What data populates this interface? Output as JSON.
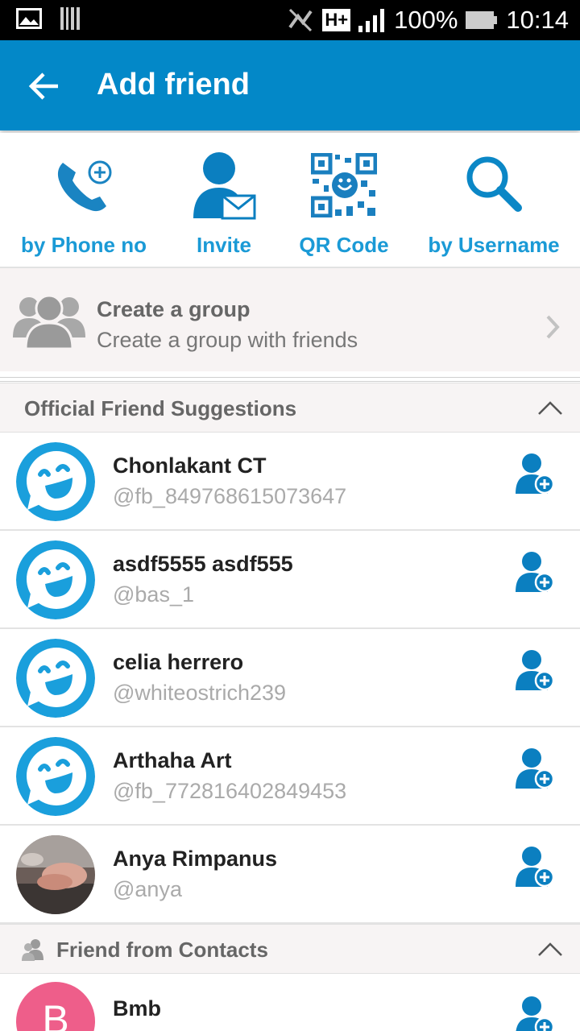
{
  "status_bar": {
    "battery": "100%",
    "time": "10:14",
    "network": "H+"
  },
  "app_bar": {
    "title": "Add friend"
  },
  "actions": [
    {
      "label": "by Phone no",
      "icon": "phone-add-icon"
    },
    {
      "label": "Invite",
      "icon": "person-mail-icon"
    },
    {
      "label": "QR Code",
      "icon": "qr-code-icon"
    },
    {
      "label": "by Username",
      "icon": "search-icon"
    }
  ],
  "group": {
    "title": "Create a group",
    "subtitle": "Create a group with friends"
  },
  "sections": {
    "suggestions": "Official Friend Suggestions",
    "contacts": "Friend from Contacts"
  },
  "friends": [
    {
      "name": "Chonlakant CT",
      "handle": "@fb_849768615073647"
    },
    {
      "name": "asdf5555 asdf555",
      "handle": "@bas_1"
    },
    {
      "name": "celia herrero",
      "handle": "@whiteostrich239"
    },
    {
      "name": "Arthaha Art",
      "handle": "@fb_772816402849453"
    },
    {
      "name": "Anya Rimpanus",
      "handle": "@anya"
    }
  ],
  "contacts": [
    {
      "name": "Bmb",
      "initial": "B"
    }
  ],
  "colors": {
    "app_bar": "#0388c8",
    "accent": "#1a9ad6",
    "contact_avatar": "#ee5e8a"
  }
}
